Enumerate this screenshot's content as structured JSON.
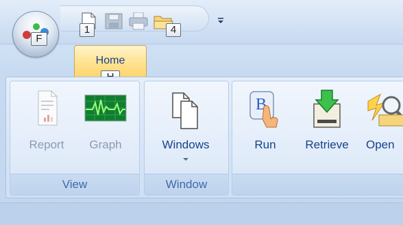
{
  "app_button": {
    "key_tip": "F"
  },
  "quick_access": {
    "buttons": [
      {
        "name": "new",
        "key_tip": "1"
      },
      {
        "name": "save",
        "key_tip": ""
      },
      {
        "name": "print",
        "key_tip": ""
      },
      {
        "name": "open",
        "key_tip": "4"
      }
    ]
  },
  "tabs": [
    {
      "label": "Home",
      "key_tip": "H",
      "selected": true
    }
  ],
  "groups": [
    {
      "label": "View",
      "buttons": [
        {
          "label": "Report",
          "icon": "report-icon",
          "enabled": false
        },
        {
          "label": "Graph",
          "icon": "graph-icon",
          "enabled": false
        }
      ]
    },
    {
      "label": "Window",
      "buttons": [
        {
          "label": "Windows",
          "icon": "windows-icon",
          "enabled": true,
          "dropdown": true
        }
      ]
    },
    {
      "label": "",
      "buttons": [
        {
          "label": "Run",
          "icon": "run-icon",
          "enabled": true
        },
        {
          "label": "Retrieve",
          "icon": "retrieve-icon",
          "enabled": true
        },
        {
          "label": "Open",
          "icon": "open-icon",
          "enabled": true
        }
      ]
    }
  ],
  "colors": {
    "accent_text": "#15428b",
    "disabled_text": "#8d9bb0",
    "tab_selected": "#ffd56e"
  }
}
